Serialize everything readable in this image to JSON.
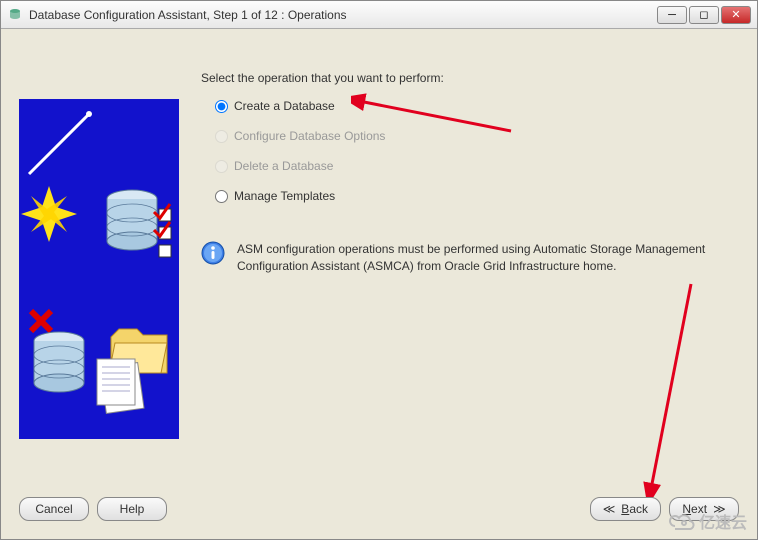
{
  "window": {
    "title": "Database Configuration Assistant, Step 1 of 12 : Operations"
  },
  "prompt": "Select the operation that you want to perform:",
  "options": {
    "create": "Create a Database",
    "configure": "Configure Database Options",
    "delete": "Delete a Database",
    "templates": "Manage Templates"
  },
  "info": {
    "text": "ASM configuration operations must be performed using Automatic Storage Management Configuration Assistant (ASMCA) from Oracle Grid Infrastructure home."
  },
  "buttons": {
    "cancel": "Cancel",
    "help": "Help",
    "back_prefix": "B",
    "back_rest": "ack",
    "next_prefix": "N",
    "next_rest": "ext"
  },
  "watermark": "亿速云"
}
